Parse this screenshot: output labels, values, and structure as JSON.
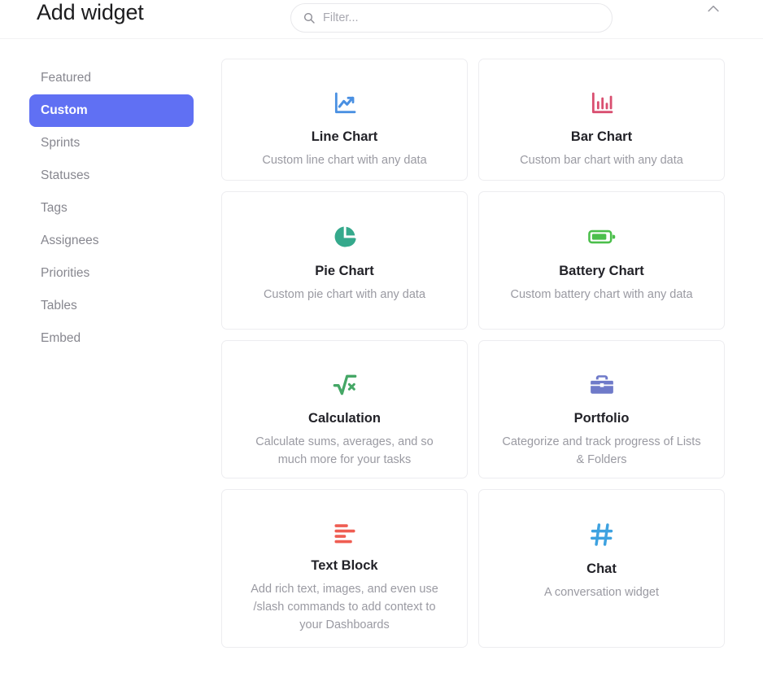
{
  "header": {
    "title": "Add widget",
    "search_placeholder": "Filter...",
    "search_value": "",
    "search_icon": "search-icon",
    "collapse_icon": "chevron-up-icon"
  },
  "sidebar": {
    "items": [
      {
        "label": "Featured",
        "active": false
      },
      {
        "label": "Custom",
        "active": true
      },
      {
        "label": "Sprints",
        "active": false
      },
      {
        "label": "Statuses",
        "active": false
      },
      {
        "label": "Tags",
        "active": false
      },
      {
        "label": "Assignees",
        "active": false
      },
      {
        "label": "Priorities",
        "active": false
      },
      {
        "label": "Tables",
        "active": false
      },
      {
        "label": "Embed",
        "active": false
      }
    ],
    "active_color": "#6070f3"
  },
  "widgets": [
    {
      "title": "Line Chart",
      "description": "Custom line chart with any data",
      "icon": "line-chart-icon",
      "icon_color": "#4a90e2"
    },
    {
      "title": "Bar Chart",
      "description": "Custom bar chart with any data",
      "icon": "bar-chart-icon",
      "icon_color": "#d94f70"
    },
    {
      "title": "Pie Chart",
      "description": "Custom pie chart with any data",
      "icon": "pie-chart-icon",
      "icon_color": "#35a98c"
    },
    {
      "title": "Battery Chart",
      "description": "Custom battery chart with any data",
      "icon": "battery-icon",
      "icon_color": "#4bbf4b"
    },
    {
      "title": "Calculation",
      "description": "Calculate sums, averages, and so much more for your tasks",
      "icon": "square-root-icon",
      "icon_color": "#45a766"
    },
    {
      "title": "Portfolio",
      "description": "Categorize and track progress of Lists & Folders",
      "icon": "briefcase-icon",
      "icon_color": "#6f7ac9"
    },
    {
      "title": "Text Block",
      "description": "Add rich text, images, and even use /slash commands to add context to your Dashboards",
      "icon": "text-lines-icon",
      "icon_color": "#ef5d52"
    },
    {
      "title": "Chat",
      "description": "A conversation widget",
      "icon": "hashtag-icon",
      "icon_color": "#3ea2e0"
    }
  ]
}
